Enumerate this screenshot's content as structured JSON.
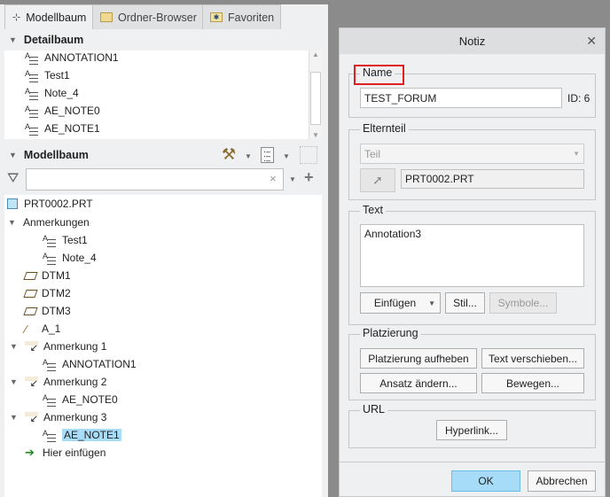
{
  "tabs": [
    {
      "label": "Modellbaum",
      "icon": "tree-icon"
    },
    {
      "label": "Ordner-Browser",
      "icon": "folders-icon"
    },
    {
      "label": "Favoriten",
      "icon": "favorites-folder-icon"
    }
  ],
  "detail_tree": {
    "title": "Detailbaum",
    "items": [
      "ANNOTATION1",
      "Test1",
      "Note_4",
      "AE_NOTE0",
      "AE_NOTE1"
    ]
  },
  "model_tree": {
    "title": "Modellbaum",
    "filter_value": "",
    "root": "PRT0002.PRT",
    "items": [
      {
        "label": "Anmerkungen",
        "type": "group",
        "depth": 0
      },
      {
        "label": "Test1",
        "type": "note",
        "depth": 1
      },
      {
        "label": "Note_4",
        "type": "note",
        "depth": 1
      },
      {
        "label": "DTM1",
        "type": "plane",
        "depth": 0
      },
      {
        "label": "DTM2",
        "type": "plane",
        "depth": 0
      },
      {
        "label": "DTM3",
        "type": "plane",
        "depth": 0
      },
      {
        "label": "A_1",
        "type": "axis",
        "depth": 0
      },
      {
        "label": "Anmerkung 1",
        "type": "annotation",
        "depth": 0
      },
      {
        "label": "ANNOTATION1",
        "type": "note",
        "depth": 1
      },
      {
        "label": "Anmerkung 2",
        "type": "annotation",
        "depth": 0
      },
      {
        "label": "AE_NOTE0",
        "type": "note",
        "depth": 1
      },
      {
        "label": "Anmerkung 3",
        "type": "annotation",
        "depth": 0
      },
      {
        "label": "AE_NOTE1",
        "type": "note",
        "depth": 1,
        "selected": true
      },
      {
        "label": "Hier einfügen",
        "type": "insert",
        "depth": 0
      }
    ]
  },
  "dialog": {
    "title": "Notiz",
    "name": {
      "legend": "Name",
      "value": "TEST_FORUM",
      "id_label": "ID: 6"
    },
    "parent": {
      "legend": "Elternteil",
      "select": "Teil",
      "part": "PRT0002.PRT"
    },
    "text": {
      "legend": "Text",
      "value": "Annotation3",
      "insert": "Einfügen",
      "style": "Stil...",
      "symbols": "Symbole..."
    },
    "placement": {
      "legend": "Platzierung",
      "unplace": "Platzierung aufheben",
      "move_text": "Text verschieben...",
      "change_origin": "Ansatz ändern...",
      "move": "Bewegen..."
    },
    "url": {
      "legend": "URL",
      "hyperlink": "Hyperlink..."
    },
    "ok": "OK",
    "cancel": "Abbrechen"
  },
  "colors": {
    "highlight": "#a9dcf7",
    "ok_button": "#a6dcf7",
    "name_box": "#e02020"
  }
}
